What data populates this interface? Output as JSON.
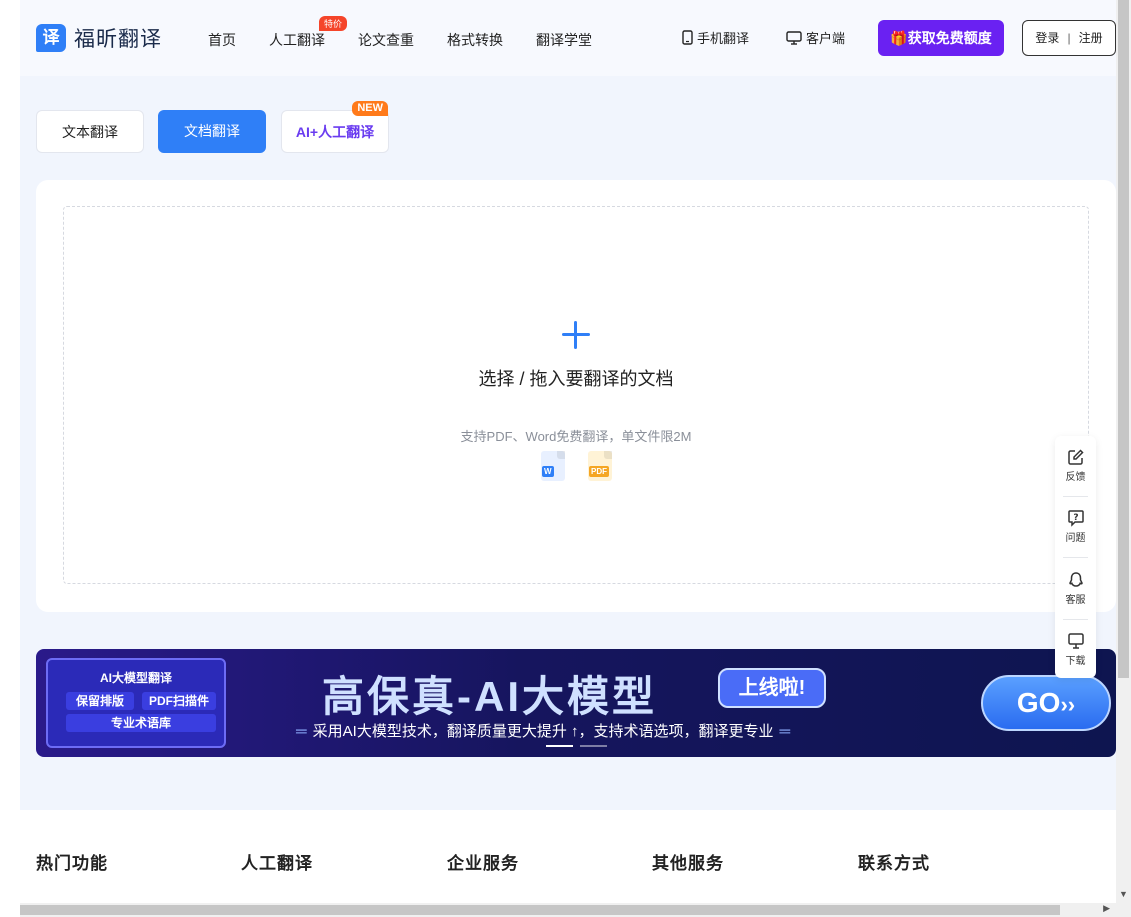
{
  "header": {
    "logo_mark": "译",
    "logo_text": "福昕翻译",
    "nav": [
      {
        "label": "首页"
      },
      {
        "label": "人工翻译",
        "badge": "特价"
      },
      {
        "label": "论文查重"
      },
      {
        "label": "格式转换"
      },
      {
        "label": "翻译学堂"
      }
    ],
    "mobile_label": "手机翻译",
    "desktop_label": "客户端",
    "free_button": "获取免费额度",
    "login": "登录",
    "register": "注册"
  },
  "tabs": [
    {
      "label": "文本翻译",
      "active": false
    },
    {
      "label": "文档翻译",
      "active": true
    },
    {
      "label": "AI+人工翻译",
      "badge": "NEW"
    }
  ],
  "upload": {
    "title": "选择 / 拖入要翻译的文档",
    "hint": "支持PDF、Word免费翻译，单文件限2M",
    "word_icon_label": "W",
    "pdf_icon_label": "PDF"
  },
  "sidebar": [
    {
      "label": "反馈",
      "icon": "edit-icon"
    },
    {
      "label": "问题",
      "icon": "question-icon"
    },
    {
      "label": "客服",
      "icon": "qq-icon"
    },
    {
      "label": "下载",
      "icon": "monitor-icon"
    }
  ],
  "banner": {
    "box_title": "AI大模型翻译",
    "chips": [
      "保留排版",
      "PDF扫描件",
      "专业术语库"
    ],
    "title": "高保真-AI大模型",
    "tag": "上线啦!",
    "subtitle": "采用AI大模型技术，翻译质量更大提升 ↑，支持术语选项，翻译更专业",
    "go": "GO"
  },
  "footer": {
    "columns": [
      "热门功能",
      "人工翻译",
      "企业服务",
      "其他服务",
      "联系方式"
    ]
  },
  "colors": {
    "primary": "#2f7ff7",
    "purple": "#6a21f2",
    "background": "#f1f5fd"
  }
}
